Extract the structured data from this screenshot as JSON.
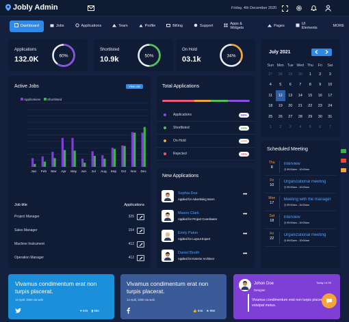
{
  "header": {
    "title": "Jobly Admin",
    "date": "Friday, 4th December 2020"
  },
  "nav": [
    {
      "label": "Dashboard",
      "icon": "dashboard-icon",
      "active": true
    },
    {
      "label": "Jobs",
      "icon": "briefcase-icon"
    },
    {
      "label": "Applications",
      "icon": "gear-icon"
    },
    {
      "label": "Team",
      "icon": "team-icon"
    },
    {
      "label": "Profile",
      "icon": "user-icon"
    },
    {
      "label": "Billing",
      "icon": "card-icon"
    },
    {
      "label": "Support",
      "icon": "lifebuoy-icon"
    },
    {
      "label": "Apps & Widgets",
      "icon": "apps-icon"
    },
    {
      "label": "Pages",
      "icon": "pages-icon"
    },
    {
      "label": "UI Elements",
      "icon": "puzzle-icon"
    },
    {
      "label": "MORE",
      "icon": ""
    }
  ],
  "stats": [
    {
      "label": "Applications",
      "value": "132.0K",
      "percent": 60,
      "pct_label": "60%",
      "color": "#8a4fe0"
    },
    {
      "label": "Shortlisted",
      "value": "10.9k",
      "percent": 50,
      "pct_label": "50%",
      "color": "#52c05a"
    },
    {
      "label": "On Hold",
      "value": "03.1k",
      "percent": 34,
      "pct_label": "34%",
      "color": "#f0a43a"
    }
  ],
  "active_jobs": {
    "title": "Active Jobs",
    "view_label": "View List",
    "col_title": "Job title",
    "col_apps": "Applications",
    "rows": [
      {
        "title": "Project Manager",
        "count": "325"
      },
      {
        "title": "Sales Manager",
        "count": "154"
      },
      {
        "title": "Machine Instrument",
        "count": "412"
      },
      {
        "title": "Operation Manager",
        "count": "412"
      }
    ]
  },
  "chart_data": {
    "type": "bar",
    "categories": [
      "Jan",
      "Feb",
      "Mar",
      "Apr",
      "May",
      "Jun",
      "Jul",
      "Aug",
      "Sep",
      "Oct",
      "Nov",
      "Dec"
    ],
    "series": [
      {
        "name": "Applications",
        "color": "#7e3fd4",
        "values": [
          15,
          18,
          26,
          50,
          50,
          14,
          27,
          20,
          33,
          37,
          60,
          59
        ]
      },
      {
        "name": "Shortlisted",
        "color": "#3bb14a",
        "values": [
          5,
          9,
          15,
          29,
          28,
          7,
          19,
          14,
          31,
          36,
          59,
          69
        ]
      }
    ],
    "ylim": [
      0,
      110
    ]
  },
  "total_apps": {
    "title": "Total Applications",
    "items": [
      {
        "label": "Applications",
        "pct": "58%",
        "color": "#8a4fe0"
      },
      {
        "label": "Shortlisted",
        "pct": "40%",
        "color": "#52c05a"
      },
      {
        "label": "On-Hold",
        "pct": "20%",
        "color": "#f0a43a"
      },
      {
        "label": "Rejected",
        "pct": "15%",
        "color": "#ef5a7a"
      }
    ]
  },
  "new_apps": {
    "title": "New Applications",
    "items": [
      {
        "name": "Sophia Doe",
        "role": "Applied for Advertising Intern"
      },
      {
        "name": "Mason Clark",
        "role": "Applied for Project Coordinator"
      },
      {
        "name": "Emily Paton",
        "role": "Applied for Layout Expert"
      },
      {
        "name": "Daniel Booth",
        "role": "Applied for Exterior Architect"
      }
    ]
  },
  "calendar": {
    "month": "July 2021",
    "days": [
      "Sun",
      "Mon",
      "Tue",
      "Wed",
      "Thu",
      "Fri",
      "Sat"
    ],
    "weeks": [
      [
        "27",
        "28",
        "29",
        "30",
        "1",
        "2",
        "3"
      ],
      [
        "4",
        "5",
        "6",
        "7",
        "8",
        "9",
        "10"
      ],
      [
        "11",
        "12",
        "13",
        "14",
        "15",
        "16",
        "17"
      ],
      [
        "18",
        "19",
        "20",
        "21",
        "22",
        "23",
        "24"
      ],
      [
        "25",
        "26",
        "27",
        "28",
        "29",
        "30",
        "31"
      ],
      [
        "1",
        "2",
        "3",
        "4",
        "5",
        "6",
        "7"
      ]
    ]
  },
  "meetings": {
    "title": "Scheduled Meeting",
    "items": [
      {
        "dow": "Thu",
        "day": "8",
        "title": "Interview",
        "time": "09:00am - 10:00am"
      },
      {
        "dow": "Fri",
        "day": "10",
        "title": "Organizational meeting",
        "time": "09:00am - 10:00am"
      },
      {
        "dow": "Mon",
        "day": "17",
        "title": "Meeting with the manager",
        "time": "09:00am - 10:00am"
      },
      {
        "dow": "Sat",
        "day": "18",
        "title": "Interview",
        "time": "09:00am - 10:00am"
      },
      {
        "dow": "Fri",
        "day": "22",
        "title": "Organizational meeting",
        "time": "09:00am - 10:00am"
      }
    ]
  },
  "bottom": [
    {
      "text": "Vivamus condimentum erat non turpis placerat.",
      "date": "14 April, 2020 via web",
      "likes": "845",
      "shares": "956",
      "network": "twitter"
    },
    {
      "text": "Vivamus condimentum erat non turpis placerat.",
      "date": "14 April, 2020 via web",
      "likes": "845",
      "shares": "956",
      "network": "facebook"
    }
  ],
  "testimonial": {
    "name": "Johon Doe",
    "role": "Designer",
    "time": "Today 14:26",
    "quote": "Vivamus condimentum erat non turpis placerat, at volutpat metus."
  }
}
